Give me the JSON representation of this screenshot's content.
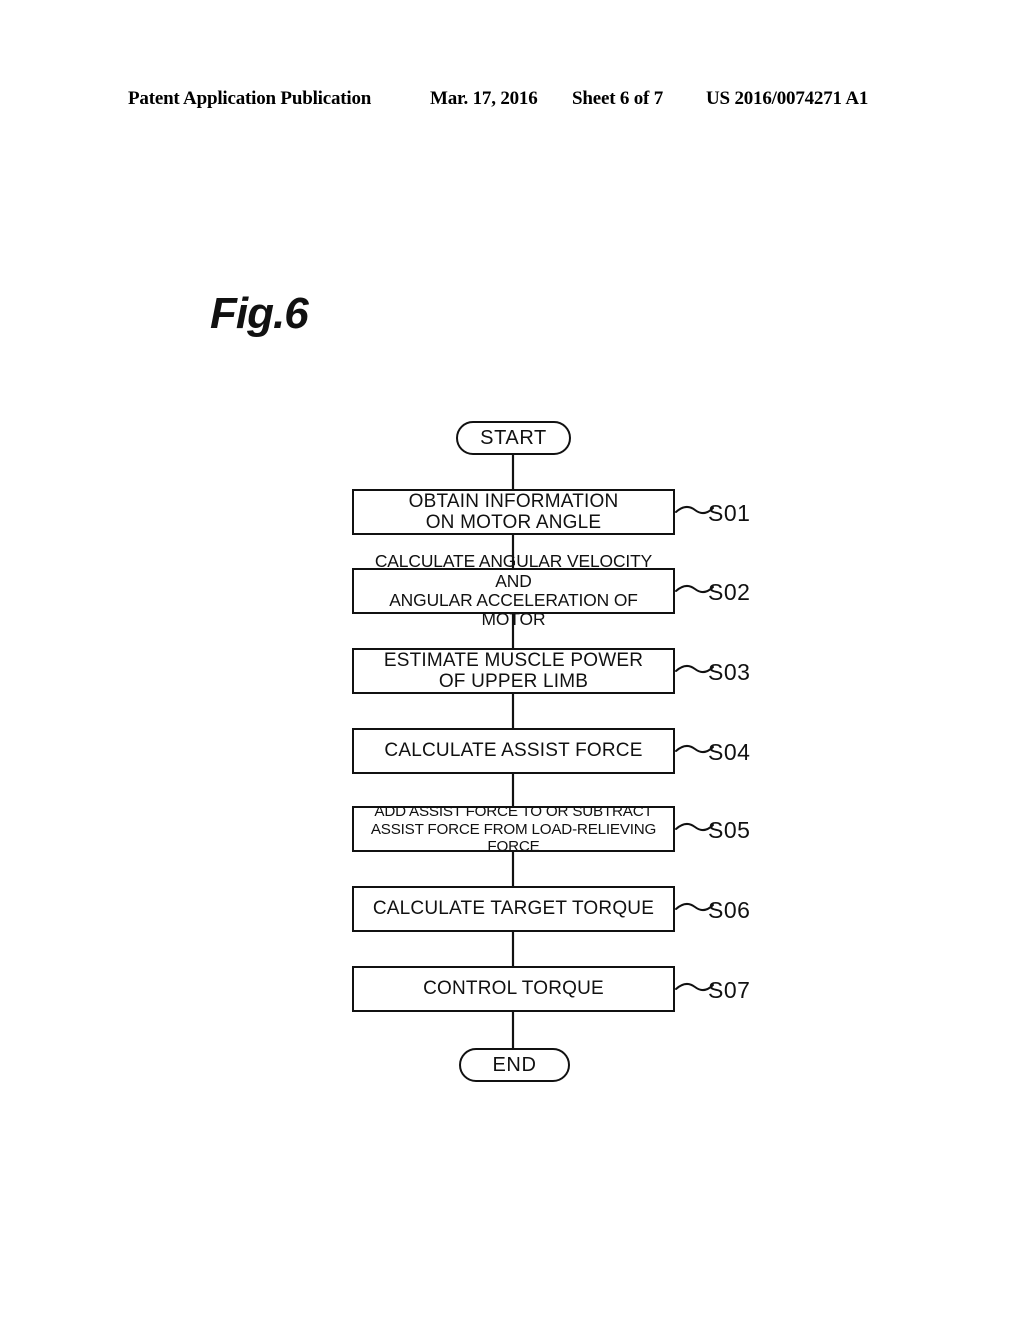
{
  "header": {
    "publication": "Patent Application Publication",
    "date": "Mar. 17, 2016",
    "sheet": "Sheet 6 of 7",
    "number": "US 2016/0074271 A1"
  },
  "figure": {
    "label": "Fig.6"
  },
  "flowchart": {
    "start_label": "START",
    "end_label": "END",
    "steps": [
      {
        "id": "S01",
        "text": "OBTAIN INFORMATION\nON MOTOR ANGLE",
        "size": "lg"
      },
      {
        "id": "S02",
        "text": "CALCULATE ANGULAR VELOCITY AND\nANGULAR ACCELERATION OF MOTOR",
        "size": "md"
      },
      {
        "id": "S03",
        "text": "ESTIMATE MUSCLE POWER\nOF UPPER LIMB",
        "size": "lg"
      },
      {
        "id": "S04",
        "text": "CALCULATE ASSIST FORCE",
        "size": "lg"
      },
      {
        "id": "S05",
        "text": "ADD ASSIST FORCE TO OR SUBTRACT\nASSIST FORCE FROM LOAD-RELIEVING FORCE",
        "size": "sm"
      },
      {
        "id": "S06",
        "text": "CALCULATE TARGET TORQUE",
        "size": "lg"
      },
      {
        "id": "S07",
        "text": "CONTROL TORQUE",
        "size": "lg"
      }
    ]
  },
  "colors": {
    "ink": "#111111",
    "page": "#ffffff"
  }
}
